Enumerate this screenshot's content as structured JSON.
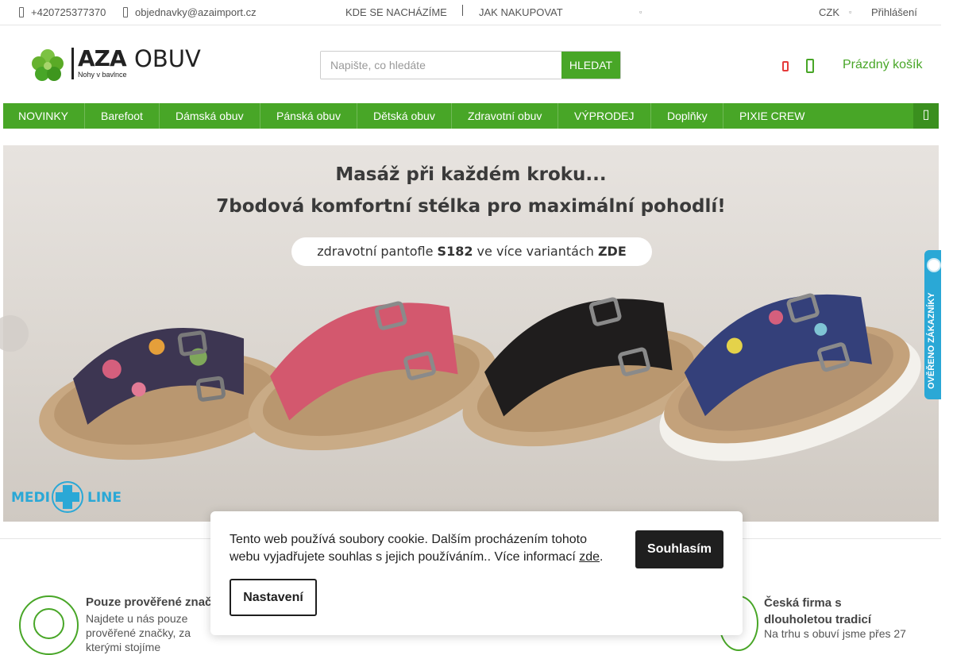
{
  "topbar": {
    "phone": "+420725377370",
    "email": "objednavky@azaimport.cz",
    "links": [
      "KDE SE NACHÁZÍME",
      "JAK NAKUPOVAT"
    ],
    "currency": "CZK",
    "login": "Přihlášení"
  },
  "logo": {
    "brand": "AZA",
    "tagline": "Nohy v bavlnce",
    "product": "OBUV"
  },
  "search": {
    "placeholder": "Napište, co hledáte",
    "button": "HLEDAT"
  },
  "cart": {
    "label": "Prázdný košík"
  },
  "nav": {
    "items": [
      "NOVINKY",
      "Barefoot",
      "Dámská obuv",
      "Pánská obuv",
      "Dětská obuv",
      "Zdravotní obuv",
      "VÝPRODEJ",
      "Doplňky",
      "PIXIE CREW"
    ]
  },
  "banner": {
    "line1": "Masáž při každém kroku...",
    "line2": "7bodová komfortní stélka pro maximální pohodlí!",
    "pill_pre": "zdravotní pantofle ",
    "pill_model": "S182",
    "pill_mid": " ve více variantách ",
    "pill_link": "ZDE",
    "brand_left": "MEDI",
    "brand_right": "LINE"
  },
  "side_badge": {
    "label": "OVĚŘENO ZÁKAZNÍKY"
  },
  "benefits": [
    {
      "title": "Pouze prověřené značky",
      "text": "Najdete u nás pouze prověřené značky, za kterými stojíme"
    },
    {
      "title": "Česká firma s dlouholetou tradicí",
      "text": "Na trhu s obuví jsme přes 27"
    }
  ],
  "cookie": {
    "message": "Tento web používá soubory cookie. Dalším procházením tohoto webu vyjadřujete souhlas s jejich používáním.. Více informací ",
    "link": "zde",
    "after": ".",
    "accept": "Souhlasím",
    "settings": "Nastavení"
  },
  "colors": {
    "brand_green": "#48a627",
    "accent_blue": "#2aa8d6",
    "favorite_red": "#e53b3b"
  }
}
